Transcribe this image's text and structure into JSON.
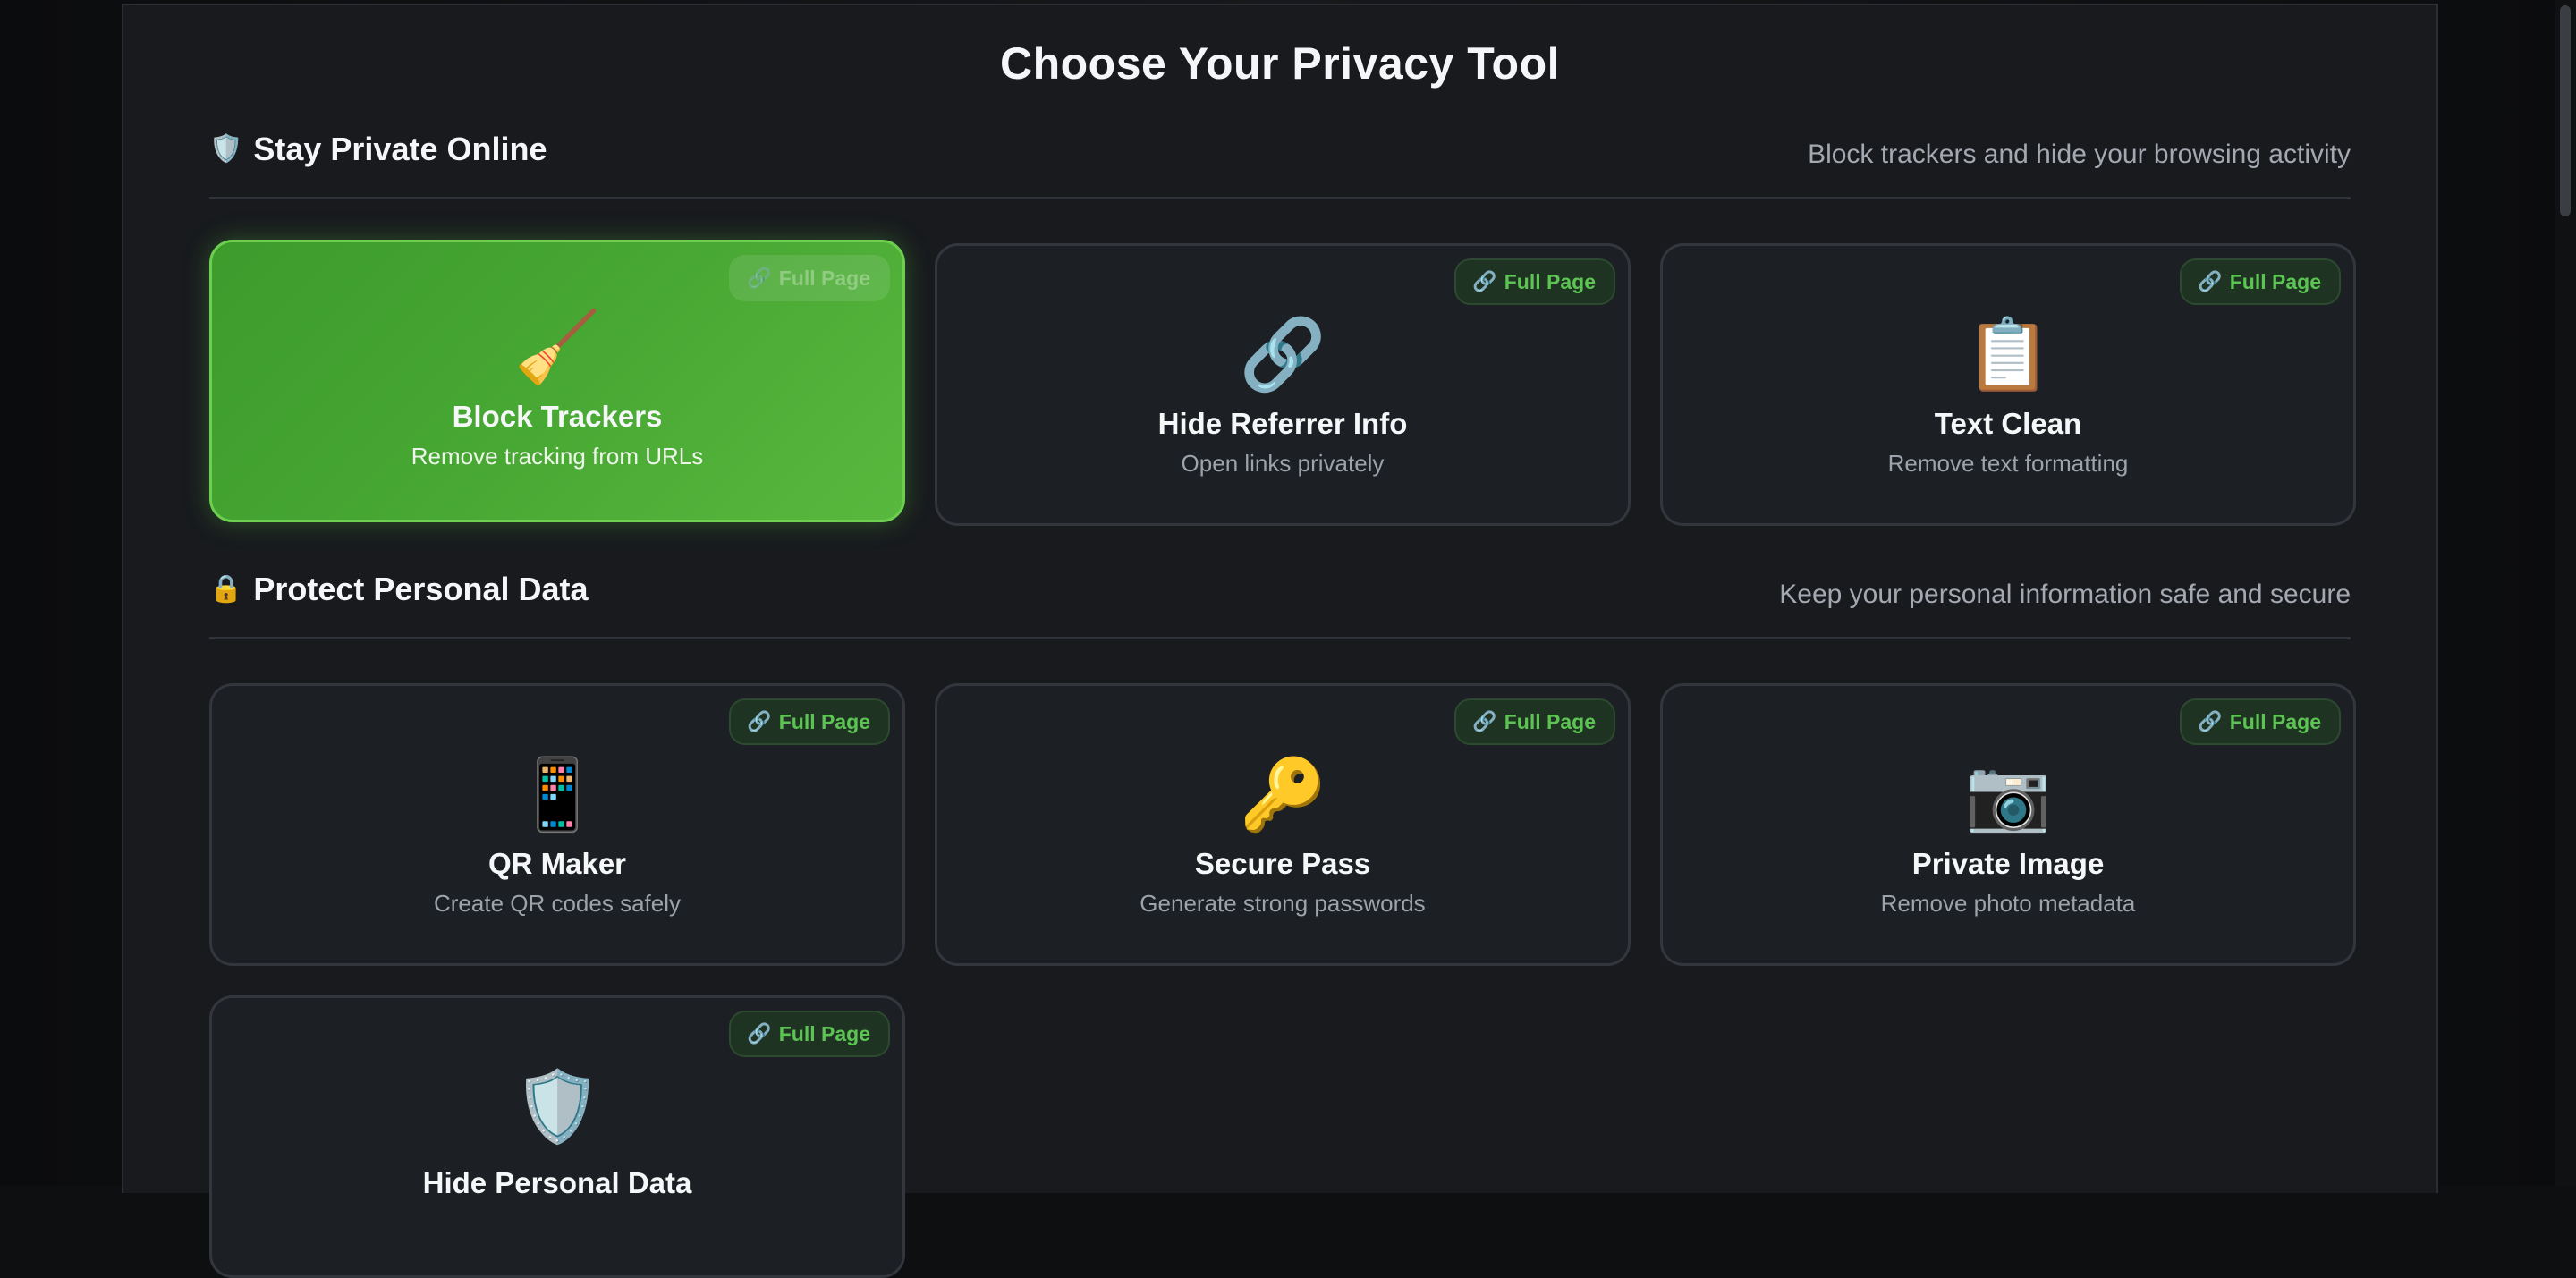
{
  "page_title": "Choose Your Privacy Tool",
  "sections": [
    {
      "icon": "🛡️",
      "icon_name": "shield-icon",
      "title": "Stay Private Online",
      "description": "Block trackers and hide your browsing activity",
      "cards": [
        {
          "icon": "🧹",
          "icon_name": "broom-icon",
          "title": "Block Trackers",
          "subtitle": "Remove tracking from URLs",
          "badge": "Full Page",
          "badge_icon": "🔗",
          "active": true
        },
        {
          "icon": "🔗",
          "icon_name": "link-icon",
          "title": "Hide Referrer Info",
          "subtitle": "Open links privately",
          "badge": "Full Page",
          "badge_icon": "🔗",
          "active": false
        },
        {
          "icon": "📋",
          "icon_name": "clipboard-icon",
          "title": "Text Clean",
          "subtitle": "Remove text formatting",
          "badge": "Full Page",
          "badge_icon": "🔗",
          "active": false
        }
      ]
    },
    {
      "icon": "🔒",
      "icon_name": "lock-icon",
      "title": "Protect Personal Data",
      "description": "Keep your personal information safe and secure",
      "cards": [
        {
          "icon": "📱",
          "icon_name": "phone-icon",
          "title": "QR Maker",
          "subtitle": "Create QR codes safely",
          "badge": "Full Page",
          "badge_icon": "🔗",
          "active": false
        },
        {
          "icon": "🔑",
          "icon_name": "key-icon",
          "title": "Secure Pass",
          "subtitle": "Generate strong passwords",
          "badge": "Full Page",
          "badge_icon": "🔗",
          "active": false
        },
        {
          "icon": "📷",
          "icon_name": "camera-icon",
          "title": "Private Image",
          "subtitle": "Remove photo metadata",
          "badge": "Full Page",
          "badge_icon": "🔗",
          "active": false
        },
        {
          "icon": "🛡️",
          "icon_name": "shield-icon",
          "title": "Hide Personal Data",
          "subtitle": "",
          "badge": "Full Page",
          "badge_icon": "🔗",
          "active": false
        }
      ]
    }
  ],
  "colors": {
    "accent_green": "#49a934",
    "badge_text": "#5cc452",
    "background": "#181a1e",
    "card_bg": "#1c1f23"
  }
}
